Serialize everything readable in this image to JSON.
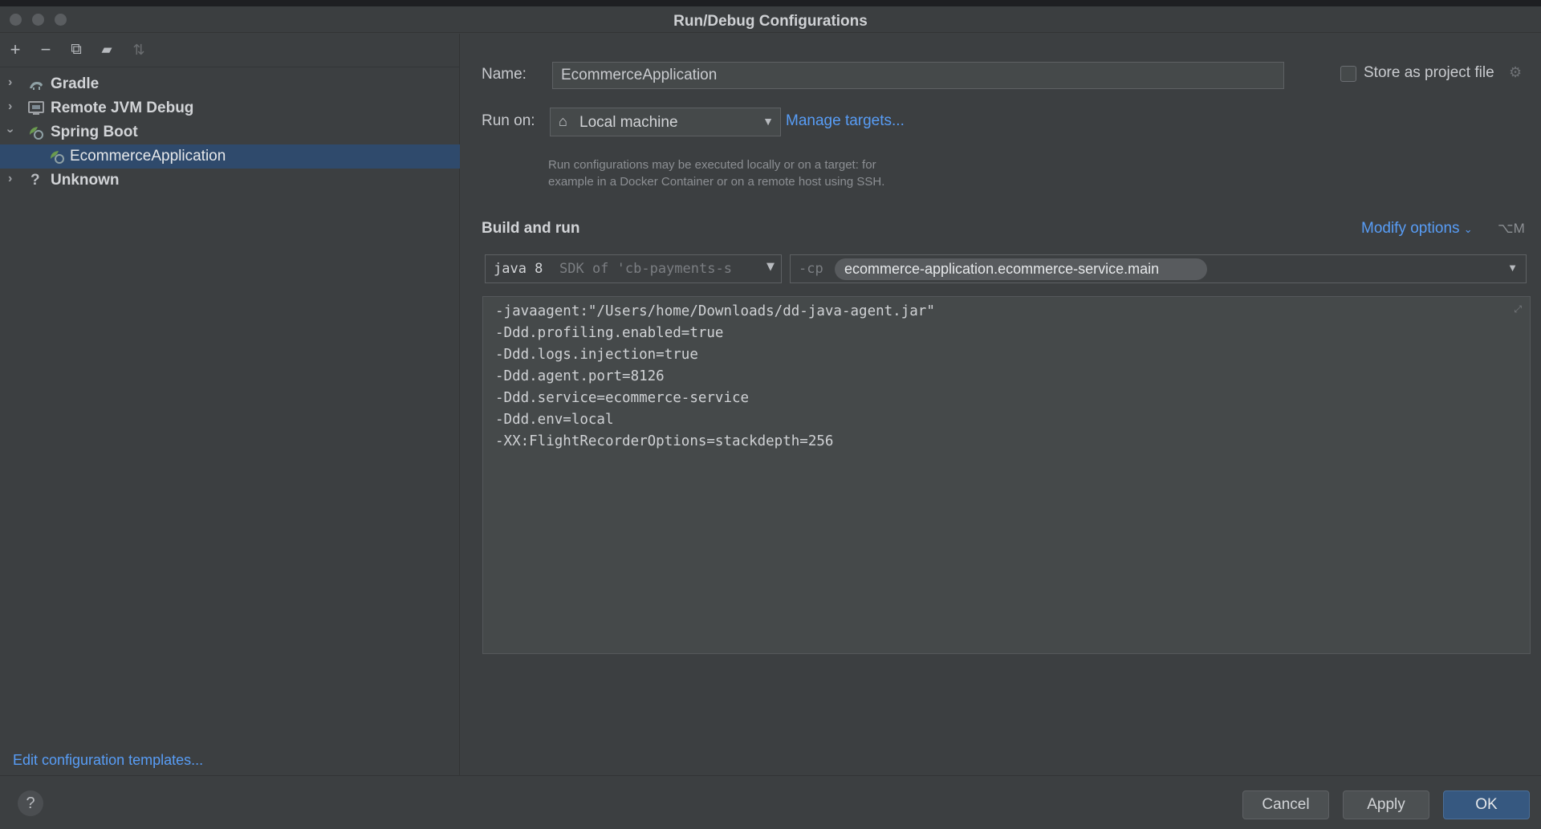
{
  "window": {
    "title": "Run/Debug Configurations"
  },
  "sidebar": {
    "toolbar": [
      {
        "name": "add",
        "glyph": "+"
      },
      {
        "name": "remove",
        "glyph": "−"
      },
      {
        "name": "copy",
        "glyph": "⧉"
      },
      {
        "name": "folder",
        "glyph": "▰"
      },
      {
        "name": "sort",
        "glyph": "⇅"
      }
    ],
    "tree": [
      {
        "label": "Gradle",
        "icon": "gradle-icon",
        "expanded": false
      },
      {
        "label": "Remote JVM Debug",
        "icon": "remote-debug-icon",
        "expanded": false
      },
      {
        "label": "Spring Boot",
        "icon": "spring-boot-icon",
        "expanded": true
      },
      {
        "label": "EcommerceApplication",
        "icon": "spring-boot-icon",
        "selected": true
      },
      {
        "label": "Unknown",
        "icon": "question-icon",
        "expanded": false
      }
    ],
    "edit_templates": "Edit configuration templates..."
  },
  "form": {
    "name_label": "Name:",
    "name_value": "EcommerceApplication",
    "store_label": "Store as project file",
    "store_checked": false,
    "runon_label": "Run on:",
    "runon_value": "Local machine",
    "manage_targets": "Manage targets...",
    "hint_line1": "Run configurations may be executed locally or on a target: for",
    "hint_line2": "example in a Docker Container or on a remote host using SSH."
  },
  "build": {
    "section_title": "Build and run",
    "modify_options": "Modify options",
    "modify_shortcut": "⌥M",
    "jdk_value": "java 8",
    "jdk_suffix": "SDK of 'cb-payments-s",
    "cp_flag": "-cp",
    "cp_module": "ecommerce-application.ecommerce-service.main",
    "vm_options": [
      "-javaagent:\"/Users/home/Downloads/dd-java-agent.jar\"",
      "-Ddd.profiling.enabled=true",
      "-Ddd.logs.injection=true",
      "-Ddd.agent.port=8126",
      "-Ddd.service=ecommerce-service",
      "-Ddd.env=local",
      "-XX:FlightRecorderOptions=stackdepth=256"
    ]
  },
  "footer": {
    "help": "?",
    "cancel": "Cancel",
    "apply": "Apply",
    "ok": "OK"
  },
  "colors": {
    "background": "#3c3f41",
    "selection": "#2f4a6c",
    "link": "#589df6",
    "primary_button": "#365880"
  }
}
